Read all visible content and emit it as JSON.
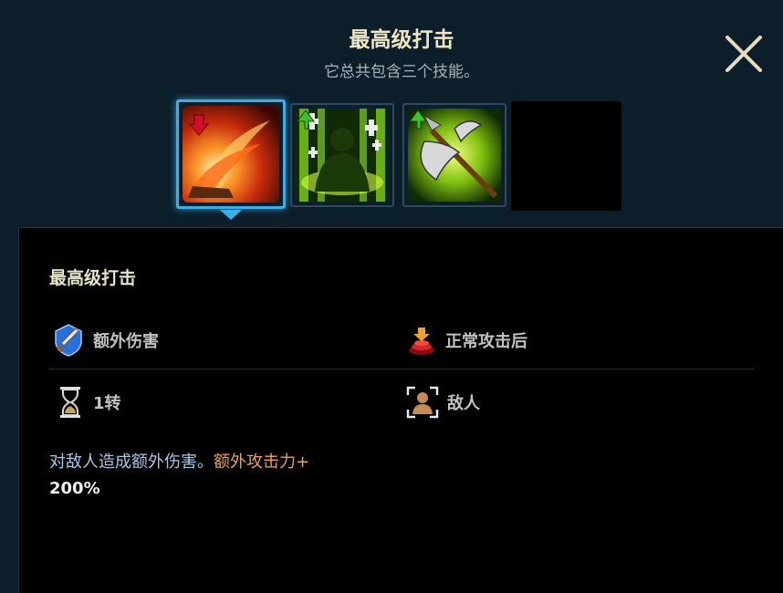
{
  "header": {
    "title": "最高级打击",
    "subtitle": "它总共包含三个技能。"
  },
  "skills": [
    {
      "name": "最高级打击",
      "icon": "fire-strike-icon",
      "state": "selected",
      "arrow": "down"
    },
    {
      "name": "",
      "icon": "green-warrior-buff-icon",
      "state": "normal",
      "arrow": "up"
    },
    {
      "name": "",
      "icon": "green-axe-icon",
      "state": "normal",
      "arrow": "up"
    },
    {
      "name": "",
      "icon": "empty-slot",
      "state": "empty"
    }
  ],
  "detail": {
    "title": "最高级打击",
    "attributes": {
      "damage_type": {
        "label": "额外伤害",
        "icon": "sword-shield-icon"
      },
      "trigger": {
        "label": "正常攻击后",
        "icon": "attack-trigger-icon"
      },
      "duration": {
        "label": "1转",
        "icon": "hourglass-icon"
      },
      "target": {
        "label": "敌人",
        "icon": "enemy-target-icon"
      }
    },
    "description": {
      "text_before": "对敌人造成额外伤害。",
      "highlight": "额外攻击力+",
      "value": " 200%"
    }
  },
  "colors": {
    "background": "#0d1e2b",
    "panel": "#000000",
    "selected_border": "#3cb0e6",
    "highlight": "#e8a35a",
    "description": "#a9c8e6"
  }
}
